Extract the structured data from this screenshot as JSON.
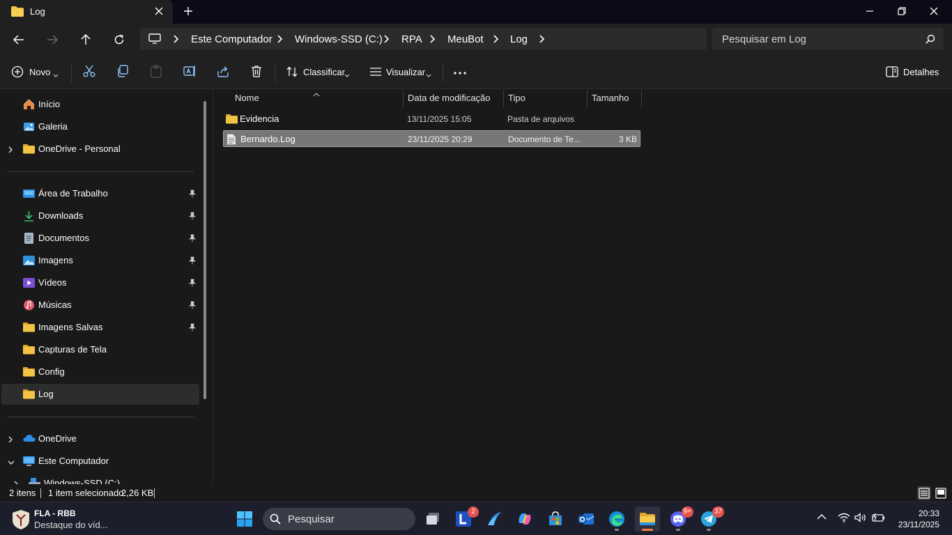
{
  "window": {
    "tab_title": "Log"
  },
  "address_bar": {
    "breadcrumbs": [
      "Este Computador",
      "Windows-SSD (C:)",
      "RPA",
      "MeuBot",
      "Log"
    ],
    "search_placeholder": "Pesquisar em Log"
  },
  "command_bar": {
    "new_label": "Novo",
    "sort_label": "Classificar",
    "view_label": "Visualizar",
    "details_label": "Detalhes"
  },
  "sidebar": {
    "top_items": [
      {
        "label": "Início",
        "icon": "home-icon"
      },
      {
        "label": "Galeria",
        "icon": "gallery-icon"
      },
      {
        "label": "OneDrive - Personal",
        "icon": "folder-icon"
      }
    ],
    "quick_access": [
      {
        "label": "Área de Trabalho",
        "icon": "desktop-icon",
        "pinned": true
      },
      {
        "label": "Downloads",
        "icon": "download-icon",
        "pinned": true
      },
      {
        "label": "Documentos",
        "icon": "documents-icon",
        "pinned": true
      },
      {
        "label": "Imagens",
        "icon": "pictures-icon",
        "pinned": true
      },
      {
        "label": "Vídeos",
        "icon": "videos-icon",
        "pinned": true
      },
      {
        "label": "Músicas",
        "icon": "music-icon",
        "pinned": true
      },
      {
        "label": "Imagens Salvas",
        "icon": "folder-icon",
        "pinned": true
      },
      {
        "label": "Capturas de Tela",
        "icon": "folder-icon",
        "pinned": false
      },
      {
        "label": "Config",
        "icon": "folder-icon",
        "pinned": false
      },
      {
        "label": "Log",
        "icon": "folder-icon",
        "pinned": false,
        "selected": true
      }
    ],
    "bottom_items": [
      {
        "label": "OneDrive",
        "icon": "cloud-icon"
      },
      {
        "label": "Este Computador",
        "icon": "computer-icon"
      },
      {
        "label": "Windows-SSD (C:)",
        "icon": "drive-icon"
      }
    ]
  },
  "file_list": {
    "columns": [
      "Nome",
      "Data de modificação",
      "Tipo",
      "Tamanho"
    ],
    "rows": [
      {
        "name": "Evidencia",
        "modified": "13/11/2025 15:05",
        "type": "Pasta de arquivos",
        "size": "",
        "icon": "folder-icon"
      },
      {
        "name": "Bernardo.Log",
        "modified": "23/11/2025 20:29",
        "type": "Documento de Te...",
        "size": "3 KB",
        "icon": "text-file-icon",
        "selected": true
      }
    ]
  },
  "status_bar": {
    "item_count": "2 itens",
    "selection": "1 item selecionado",
    "selection_size": "2,26 KB"
  },
  "taskbar": {
    "news_title": "FLA - RBB",
    "news_subtitle": "Destaque do víd...",
    "search_label": "Pesquisar",
    "badges": {
      "lexis": "2",
      "discord": "9+",
      "telegram": "37"
    },
    "time": "20:33",
    "date": "23/11/2025"
  },
  "colors": {
    "background": "#191919",
    "toolbar": "#202020",
    "folder": "#f3c443",
    "selection": "#777777",
    "taskbar": "#1c1f2b",
    "badge": "#e5514b",
    "active_indicator": "#ff7a45"
  }
}
